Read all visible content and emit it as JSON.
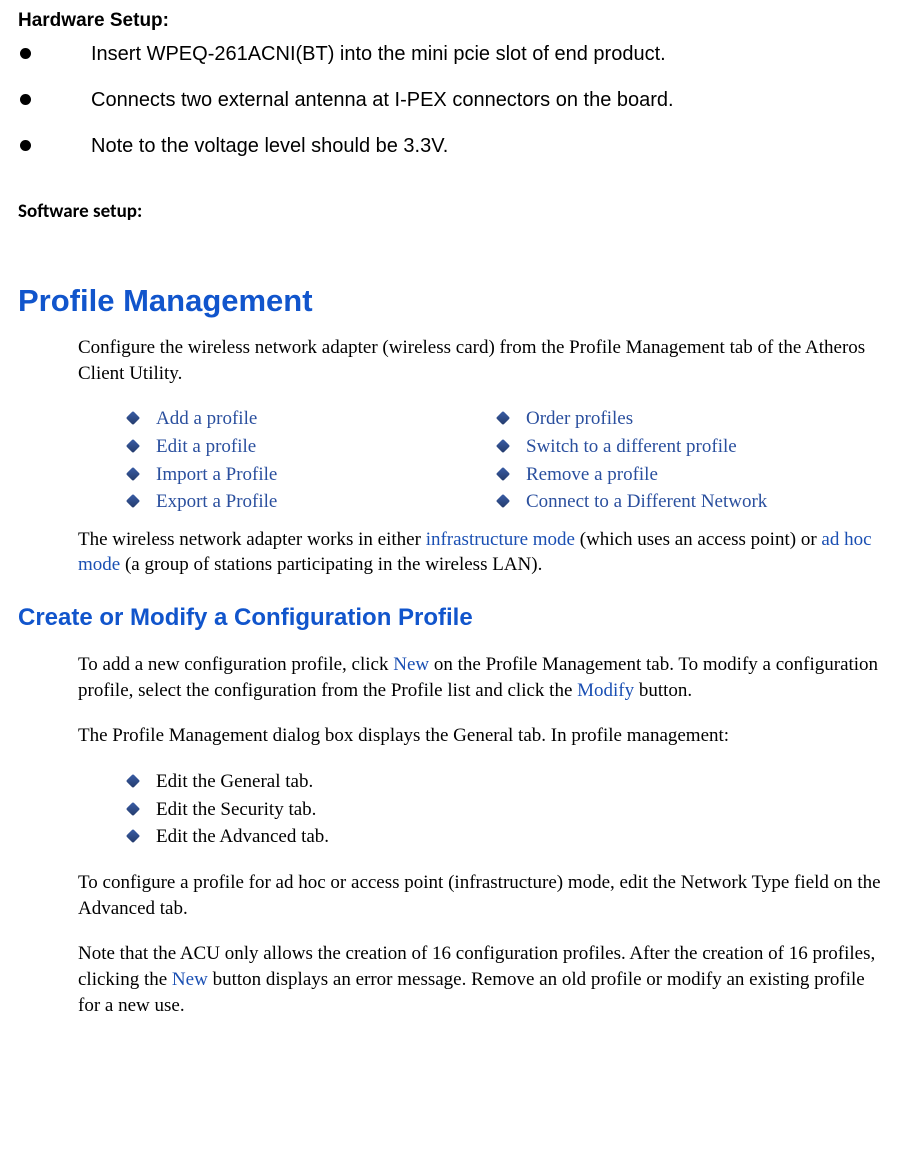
{
  "hardware": {
    "heading": "Hardware Setup:",
    "items": [
      "Insert WPEQ-261ACNI(BT) into the mini pcie slot of end product.",
      "Connects two external antenna at I-PEX connectors on the board.",
      "Note to the voltage level should be 3.3V."
    ]
  },
  "software": {
    "heading": "Software setup:"
  },
  "profile_mgmt": {
    "title": "Profile Management",
    "intro": "Configure the wireless network adapter (wireless card) from the Profile Management tab of the Atheros Client Utility.",
    "links_left": [
      "Add a profile",
      "Edit a profile",
      "Import a Profile",
      "Export a Profile"
    ],
    "links_right": [
      "Order profiles",
      "Switch to a different profile",
      "Remove a profile",
      "Connect to a Different Network"
    ],
    "modes_para": {
      "pre": "The wireless network adapter works in either ",
      "link1": "infrastructure mode",
      "mid": " (which uses an access point) or ",
      "link2": "ad hoc mode",
      "post": " (a group of stations participating in the wireless LAN)."
    }
  },
  "create_modify": {
    "title": "Create or Modify a Configuration Profile",
    "p1": {
      "pre": "To add a new configuration profile, click ",
      "new": "New",
      "mid": " on the Profile Management tab. To modify a configuration profile, select the configuration from the Profile list and click the ",
      "modify": "Modify",
      "post": " button."
    },
    "p2": "The Profile Management dialog box displays the General tab.  In profile management:",
    "tabs": [
      "Edit the General tab.",
      "Edit the Security tab.",
      "Edit the Advanced tab."
    ],
    "p3": "To configure a profile for ad hoc or access point (infrastructure) mode, edit the Network Type field on the Advanced tab.",
    "p4": {
      "pre": "Note that the ACU only allows the creation of 16 configuration profiles.  After the creation of 16 profiles, clicking the ",
      "new": "New",
      "post": " button displays an error message.  Remove an old profile or modify an existing profile for a new use."
    }
  }
}
